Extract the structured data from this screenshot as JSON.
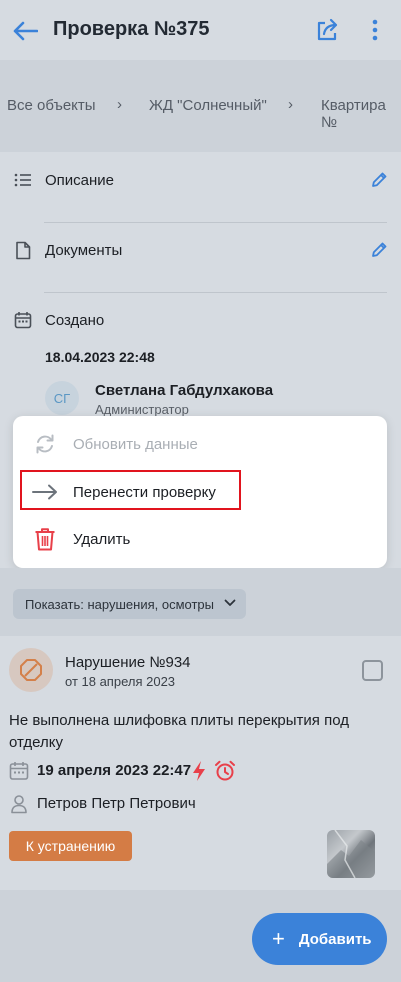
{
  "header": {
    "title": "Проверка №375",
    "back_icon": "arrow-left-icon",
    "share_icon": "share-icon",
    "more_icon": "more-vertical-icon"
  },
  "breadcrumbs": [
    "Все объекты",
    "ЖД \"Солнечный\"",
    "Квартира №"
  ],
  "info": {
    "description_label": "Описание",
    "documents_label": "Документы",
    "created_label": "Создано",
    "created_date": "18.04.2023 22:48",
    "user": {
      "initials": "СГ",
      "name": "Светлана Габдулхакова",
      "role": "Администратор"
    }
  },
  "menu": {
    "refresh_label": "Обновить данные",
    "move_label": "Перенести проверку",
    "delete_label": "Удалить"
  },
  "filter": {
    "label": "Показать: нарушения, осмотры"
  },
  "violation": {
    "title": "Нарушение №934",
    "date": "от 18 апреля 2023",
    "description": "Не выполнена шлифовка плиты перекрытия под отделку",
    "due": "19 апреля 2023 22:47",
    "assignee": "Петров Петр Петрович",
    "status": "К устранению",
    "checked": false
  },
  "fab": {
    "label": "Добавить"
  },
  "colors": {
    "accent": "#3b82d9",
    "danger": "#e1141e",
    "status": "#d47c45"
  }
}
